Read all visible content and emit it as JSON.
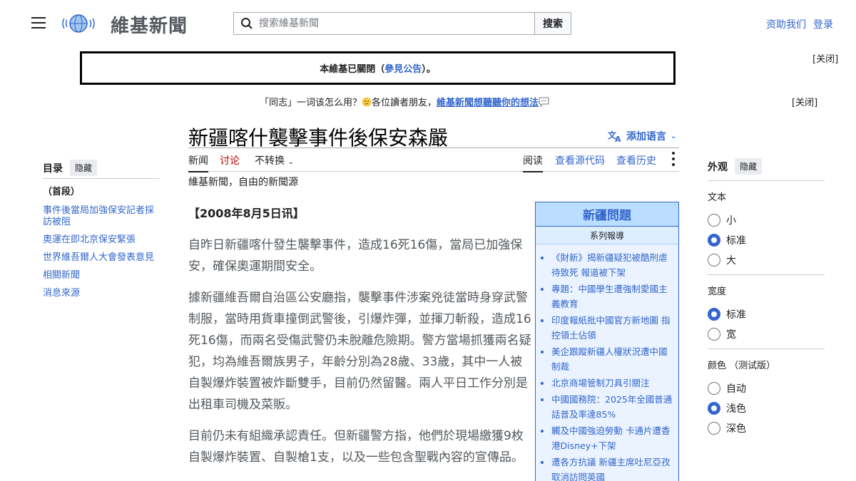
{
  "header": {
    "logo_text": "維基新聞",
    "search_placeholder": "搜索維基新聞",
    "search_button": "搜索",
    "user_links": [
      "资助我们",
      "登录"
    ]
  },
  "notices": {
    "close_label": "[关闭]",
    "closed_notice_prefix": "本維基已關閉（",
    "closed_notice_link": "參見公告",
    "closed_notice_suffix": "）。",
    "survey_prefix": "「同志」一词该怎么用？",
    "survey_middle": "各位讀者朋友，",
    "survey_link": "維基新聞想聽聽你的想法"
  },
  "page": {
    "title": "新疆喀什襲擊事件後保安森嚴",
    "add_language": "添加语言",
    "tabs_left": [
      "新闻",
      "讨论",
      "不转换"
    ],
    "tabs_right": [
      "阅读",
      "查看源代码",
      "查看历史"
    ],
    "tagline": "維基新聞，自由的新聞源"
  },
  "toc": {
    "title": "目录",
    "hide": "隐藏",
    "items": [
      "（首段）",
      "事件後當局加強保安記者採訪被阻",
      "奧運在即北京保安緊張",
      "世界維吾爾人大會發表意見",
      "相關新聞",
      "消息來源"
    ]
  },
  "article": {
    "dateline": "【2008年8月5日讯】",
    "paragraphs": [
      "自昨日新疆喀什發生襲擊事件，造成16死16傷，當局已加強保安，確保奧運期間安全。",
      "據新疆維吾爾自治區公安廳指，襲擊事件涉案兇徒當時身穿武警制服，當時用貨車撞倒武警後，引爆炸彈，並揮刀斬殺，造成16死16傷，而兩名受傷武警仍未脫離危險期。警方當場抓獲兩名疑犯，均為維吾爾族男子，年齡分別為28歲、33歲，其中一人被自製爆炸裝置被炸斷雙手，目前仍然留醫。兩人平日工作分別是出租車司機及菜販。",
      "目前仍未有組織承認責任。但新疆警方指，他們於現場繳獲9枚自製爆炸裝置、自製槍1支，以及一些包含聖戰內容的宣傳品。"
    ]
  },
  "infobox": {
    "title": "新疆問題",
    "subtitle": "系列報導",
    "items": [
      "《財新》揭新疆疑犯被酷刑虐待致死 報道被下架",
      "專題：中國學生遭強制愛國主義教育",
      "印度報紙批中國官方新地圖 指控領土佔領",
      "美企跟蹤新疆人權狀況遭中國制裁",
      "北京商場管制刀具引關注",
      "中國國務院：2025年全國普通話普及率達85%",
      "觸及中國強迫勞動 卡通片遭香港Disney+下架",
      "遭各方抗議 新疆主席吐尼亞孜取消訪問英國"
    ]
  },
  "appearance": {
    "title": "外观",
    "hide": "隐藏",
    "text_label": "文本",
    "text_options": [
      "小",
      "标准",
      "大"
    ],
    "text_selected": 1,
    "width_label": "宽度",
    "width_options": [
      "标准",
      "宽"
    ],
    "width_selected": 0,
    "color_label": "颜色 （测试版）",
    "color_options": [
      "自动",
      "浅色",
      "深色"
    ],
    "color_selected": 1
  }
}
